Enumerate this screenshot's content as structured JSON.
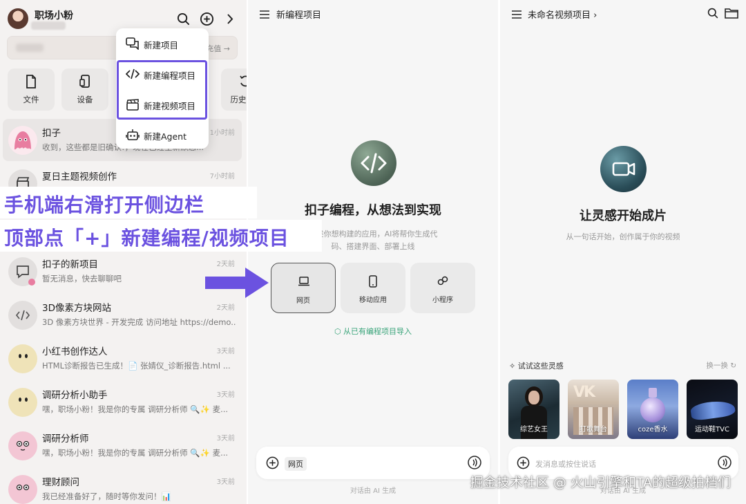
{
  "left": {
    "user": {
      "name": "职场小粉"
    },
    "banner": {
      "action": "充值"
    },
    "quick": [
      {
        "label": "文件"
      },
      {
        "label": "设备"
      },
      {
        "label": "历史"
      }
    ],
    "menu": [
      {
        "label": "新建项目"
      },
      {
        "label": "新建编程项目"
      },
      {
        "label": "新建视频项目"
      },
      {
        "label": "新建Agent"
      }
    ],
    "chats": [
      {
        "name": "扣子",
        "msg": "收到，这些都是旧确认!，现在已经全新默忍...",
        "time": "1小时前"
      },
      {
        "name": "夏日主题视频创作",
        "msg": "",
        "time": "7小时前"
      },
      {
        "name": "扣子的新项目",
        "msg": "暂无消息，快去聊聊吧",
        "time": "2天前"
      },
      {
        "name": "3D像素方块网站",
        "msg": "3D 像素方块世界 - 开发完成 访问地址 https://demo...",
        "time": "2天前"
      },
      {
        "name": "小红书创作达人",
        "msg": "HTML诊断报告已生成！📄 张婧仪_诊断报告.html ...",
        "time": "3天前"
      },
      {
        "name": "调研分析小助手",
        "msg": "嘿，职场小粉！我是你的专属 调研分析师 🔍✨ 麦...",
        "time": "3天前"
      },
      {
        "name": "调研分析师",
        "msg": "嘿，职场小粉！我是你的专属 调研分析师 🔍✨ 麦...",
        "time": "3天前"
      },
      {
        "name": "理财顾问",
        "msg": "我已经准备好了，随时等你发问！📊",
        "time": "3天前"
      }
    ],
    "overlay": {
      "line1": "手机端右滑打开侧边栏",
      "line2": "顶部点「+」新建编程/视频项目"
    }
  },
  "middle": {
    "header": "新编程项目",
    "title": "扣子编程，从想法到实现",
    "desc1": "描述你想构建的应用，AI将帮你生成代",
    "desc2": "码、搭建界面、部署上线",
    "options": [
      {
        "label": "网页"
      },
      {
        "label": "移动应用"
      },
      {
        "label": "小程序"
      }
    ],
    "import": "从已有编程项目导入",
    "composer_tag": "网页",
    "footer": "对话由 AI 生成"
  },
  "right": {
    "header": "未命名视频项目",
    "title": "让灵感开始成片",
    "desc": "从一句话开始，创作属于你的视频",
    "try_label": "试试这些灵感",
    "refresh": "换一换",
    "thumbs": [
      {
        "label": "综艺女王"
      },
      {
        "label": "打歌舞台"
      },
      {
        "label": "coze香水"
      },
      {
        "label": "运动鞋TVC"
      }
    ],
    "composer_placeholder": "发消息或按住说话",
    "footer": "对话由 AI 生成"
  },
  "watermark": "掘金技术社区 @ 火山引擎和TA的超级拍档们",
  "colors": {
    "accent": "#6b52e0",
    "green": "#3aa47a"
  }
}
